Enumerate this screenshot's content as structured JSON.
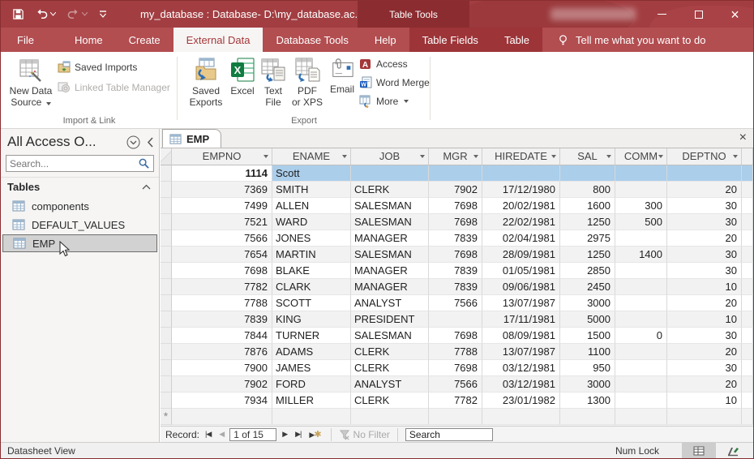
{
  "titlebar": {
    "title": "my_database : Database- D:\\my_database.ac...",
    "contextual_label": "Table Tools"
  },
  "tabs": {
    "items": [
      {
        "label": "File"
      },
      {
        "label": "Home"
      },
      {
        "label": "Create"
      },
      {
        "label": "External Data"
      },
      {
        "label": "Database Tools"
      },
      {
        "label": "Help"
      }
    ],
    "contextual": [
      {
        "label": "Table Fields"
      },
      {
        "label": "Table"
      }
    ],
    "tell_me": "Tell me what you want to do"
  },
  "ribbon": {
    "import_link": {
      "group_label": "Import & Link",
      "new_data_source_1": "New Data",
      "new_data_source_2": "Source",
      "saved_imports": "Saved Imports",
      "linked_table_manager": "Linked Table Manager"
    },
    "export": {
      "group_label": "Export",
      "saved_exports_1": "Saved",
      "saved_exports_2": "Exports",
      "excel": "Excel",
      "text_file_1": "Text",
      "text_file_2": "File",
      "pdf_1": "PDF",
      "pdf_2": "or XPS",
      "email": "Email",
      "access": "Access",
      "word_merge": "Word Merge",
      "more": "More"
    }
  },
  "nav_pane": {
    "title": "All Access O...",
    "search_placeholder": "Search...",
    "section_label": "Tables",
    "items": [
      {
        "label": "components"
      },
      {
        "label": "DEFAULT_VALUES"
      },
      {
        "label": "EMP"
      }
    ]
  },
  "document": {
    "tab_label": "EMP"
  },
  "table": {
    "columns": [
      "EMPNO",
      "ENAME",
      "JOB",
      "MGR",
      "HIREDATE",
      "SAL",
      "COMM",
      "DEPTNO"
    ],
    "new_record": {
      "EMPNO": "1114",
      "ENAME": "Scott"
    },
    "rows": [
      [
        "7369",
        "SMITH",
        "CLERK",
        "7902",
        "17/12/1980",
        "800",
        "",
        "20"
      ],
      [
        "7499",
        "ALLEN",
        "SALESMAN",
        "7698",
        "20/02/1981",
        "1600",
        "300",
        "30"
      ],
      [
        "7521",
        "WARD",
        "SALESMAN",
        "7698",
        "22/02/1981",
        "1250",
        "500",
        "30"
      ],
      [
        "7566",
        "JONES",
        "MANAGER",
        "7839",
        "02/04/1981",
        "2975",
        "",
        "20"
      ],
      [
        "7654",
        "MARTIN",
        "SALESMAN",
        "7698",
        "28/09/1981",
        "1250",
        "1400",
        "30"
      ],
      [
        "7698",
        "BLAKE",
        "MANAGER",
        "7839",
        "01/05/1981",
        "2850",
        "",
        "30"
      ],
      [
        "7782",
        "CLARK",
        "MANAGER",
        "7839",
        "09/06/1981",
        "2450",
        "",
        "10"
      ],
      [
        "7788",
        "SCOTT",
        "ANALYST",
        "7566",
        "13/07/1987",
        "3000",
        "",
        "20"
      ],
      [
        "7839",
        "KING",
        "PRESIDENT",
        "",
        "17/11/1981",
        "5000",
        "",
        "10"
      ],
      [
        "7844",
        "TURNER",
        "SALESMAN",
        "7698",
        "08/09/1981",
        "1500",
        "0",
        "30"
      ],
      [
        "7876",
        "ADAMS",
        "CLERK",
        "7788",
        "13/07/1987",
        "1100",
        "",
        "20"
      ],
      [
        "7900",
        "JAMES",
        "CLERK",
        "7698",
        "03/12/1981",
        "950",
        "",
        "30"
      ],
      [
        "7902",
        "FORD",
        "ANALYST",
        "7566",
        "03/12/1981",
        "3000",
        "",
        "20"
      ],
      [
        "7934",
        "MILLER",
        "CLERK",
        "7782",
        "23/01/1982",
        "1300",
        "",
        "10"
      ]
    ]
  },
  "record_nav": {
    "label": "Record:",
    "position": "1 of 15",
    "no_filter": "No Filter",
    "search_value": "Search"
  },
  "status_bar": {
    "view_label": "Datasheet View",
    "num_lock": "Num Lock"
  },
  "colors": {
    "accent_red": "#b24d50",
    "contextual_red": "#8b2c30",
    "titlebar_red": "#a23e42",
    "selection_blue": "#abceeb",
    "excel_green": "#107c41",
    "access_red": "#a4373a",
    "word_blue": "#185abd"
  }
}
